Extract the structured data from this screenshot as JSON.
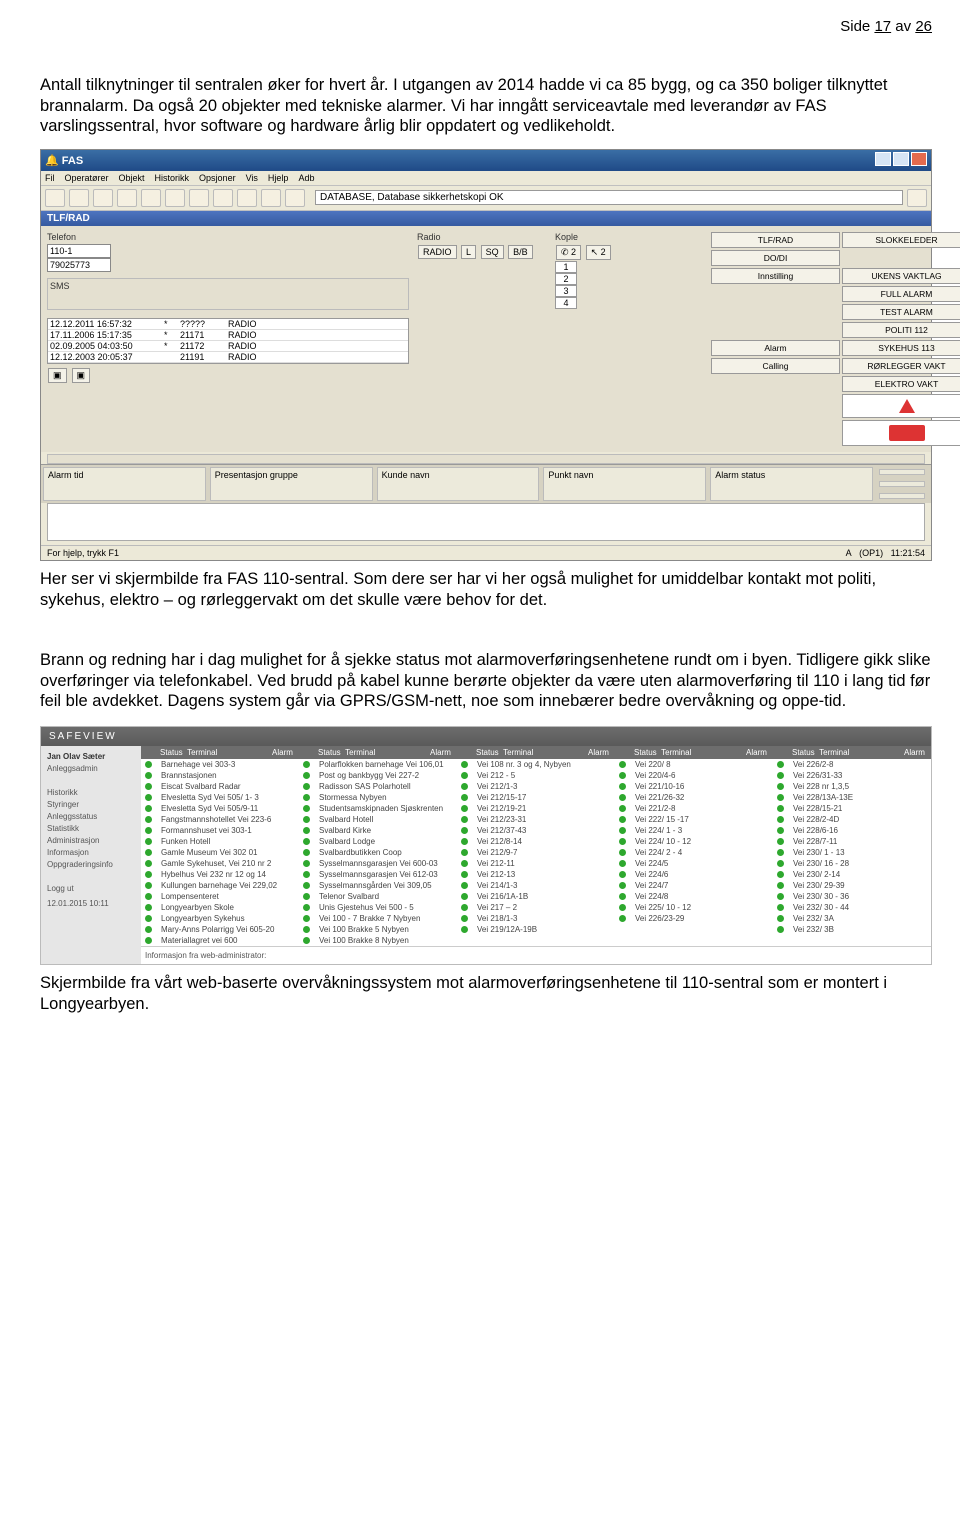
{
  "page_number_prefix": "Side ",
  "page_number_cur": "17",
  "page_number_mid": " av ",
  "page_number_total": "26",
  "para1": "Antall tilknytninger til sentralen øker for hvert år. I utgangen av 2014 hadde vi ca 85 bygg, og ca 350 boliger tilknyttet brannalarm. Da også 20 objekter med tekniske alarmer. Vi har inngått serviceavtale med leverandør av FAS varslingssentral, hvor software og hardware årlig blir oppdatert og vedlikeholdt.",
  "para2": "Her ser vi skjermbilde fra FAS 110-sentral. Som dere ser har vi her også mulighet for umiddelbar kontakt mot politi, sykehus, elektro – og rørleggervakt om det skulle være behov for det.",
  "para3": "Brann og redning har i dag mulighet for å sjekke status mot alarmoverføringsenhetene rundt om i byen. Tidligere gikk slike overføringer via telefonkabel. Ved brudd på kabel kunne berørte objekter da være uten alarmoverføring til 110 i lang tid før feil ble avdekket. Dagens system går via GPRS/GSM-nett, noe som innebærer bedre overvåkning og oppe-tid.",
  "para4": "Skjermbilde fra vårt web-baserte overvåkningssystem mot alarmoverføringsenhetene til 110-sentral som er montert i Longyearbyen.",
  "fas": {
    "title": "FAS",
    "menu": [
      "Fil",
      "Operatører",
      "Objekt",
      "Historikk",
      "Opsjoner",
      "Vis",
      "Hjelp",
      "Adb"
    ],
    "db_label": "DATABASE, Database sikkerhetskopi OK",
    "tlfrad": "TLF/RAD",
    "grp_tel": "Telefon",
    "grp_radio": "Radio",
    "grp_kople": "Kople",
    "tel1": "110-1",
    "tel2": "79025773",
    "radiobtn": "RADIO",
    "r_l": "L",
    "r_sq": "SQ",
    "r_bb": "B/B",
    "kople_hand1": "✆ 2",
    "kople_hand2": "↖ 2",
    "kople_nums": [
      "1",
      "2",
      "3",
      "4"
    ],
    "sms": "SMS",
    "log": [
      {
        "t": "12.12.2011 16:57:32",
        "s": "*",
        "c": "?????",
        "r": "RADIO"
      },
      {
        "t": "17.11.2006 15:17:35",
        "s": "*",
        "c": "21171",
        "r": "RADIO"
      },
      {
        "t": "02.09.2005 04:03:50",
        "s": "*",
        "c": "21172",
        "r": "RADIO"
      },
      {
        "t": "12.12.2003 20:05:37",
        "s": "",
        "c": "21191",
        "r": "RADIO"
      }
    ],
    "right_top": [
      [
        "TLF/RAD",
        "SLOKKELEDER"
      ],
      [
        "DO/DI",
        ""
      ],
      [
        "Innstilling",
        "UKENS VAKTLAG"
      ],
      [
        "",
        "FULL ALARM"
      ],
      [
        "",
        "TEST ALARM"
      ],
      [
        "",
        "POLITI 112"
      ],
      [
        "Alarm",
        "SYKEHUS 113"
      ],
      [
        "Calling",
        "RØRLEGGER VAKT"
      ],
      [
        "",
        "ELEKTRO VAKT"
      ]
    ],
    "alarm_cols": [
      "Alarm tid",
      "Presentasjon gruppe",
      "Kunde navn",
      "Punkt navn",
      "Alarm status"
    ],
    "statusbar_left": "For hjelp, trykk F1",
    "statusbar_a": "A",
    "statusbar_op": "(OP1)",
    "statusbar_time": "11:21:54"
  },
  "sv": {
    "brand": "SAFEVIEW",
    "user": "Jan Olav Sæter",
    "side": [
      "Anleggsadmin",
      "",
      "Historikk",
      "Styringer",
      "Anleggsstatus",
      "Statistikk",
      "Administrasjon",
      "Informasjon",
      "Oppgraderingsinfo",
      "",
      "Logg ut"
    ],
    "timestamp": "12.01.2015\n10:11",
    "hdr": [
      "Status",
      "Terminal",
      "Alarm"
    ],
    "cols": [
      [
        "Barnehage vei 303-3",
        "Brannstasjonen",
        "Eiscat Svalbard Radar",
        "Elvesletta Syd Vei 505/ 1- 3",
        "Elvesletta Syd Vei 505/9-11",
        "Fangstmannshotellet Vei 223-6",
        "Formannshuset vei 303-1",
        "Funken Hotell",
        "Gamle Museum Vei 302 01",
        "Gamle Sykehuset, Vei 210 nr 2",
        "Hybelhus Vei 232 nr 12 og 14",
        "Kullungen barnehage Vei 229,02",
        "Lompensenteret",
        "Longyearbyen Skole",
        "Longyearbyen Sykehus",
        "Mary-Anns Polarrigg Vei 605-20",
        "Materiallagret vei 600"
      ],
      [
        "Polarflokken barnehage Vei 106,01",
        "Post og bankbygg Vei 227-2",
        "Radisson SAS Polarhotell",
        "Stormessa Nybyen",
        "Studentsamskipnaden Sjøskrenten",
        "Svalbard Hotell",
        "Svalbard Kirke",
        "Svalbard Lodge",
        "Svalbardbutikken Coop",
        "Sysselmannsgarasjen Vei 600-03",
        "Sysselmannsgarasjen Vei 612-03",
        "Sysselmannsgården Vei 309,05",
        "Telenor Svalbard",
        "Unis Gjestehus Vei 500 - 5",
        "Vei 100 - 7 Brakke 7 Nybyen",
        "Vei 100 Brakke 5 Nybyen",
        "Vei 100 Brakke 8 Nybyen"
      ],
      [
        "Vei 108 nr. 3 og 4, Nybyen",
        "Vei 212 - 5",
        "Vei 212/1-3",
        "Vei 212/15-17",
        "Vei 212/19-21",
        "Vei 212/23-31",
        "Vei 212/37-43",
        "Vei 212/8-14",
        "Vei 212/9-7",
        "Vei 212-11",
        "Vei 212-13",
        "Vei 214/1-3",
        "Vei 216/1A-1B",
        "Vei 217 – 2",
        "Vei 218/1-3",
        "Vei 219/12A-19B"
      ],
      [
        "Vei 220/ 8",
        "Vei 220/4-6",
        "Vei 221/10-16",
        "Vei 221/26-32",
        "Vei 221/2-8",
        "Vei 222/ 15 -17",
        "Vei 224/ 1 - 3",
        "Vei 224/ 10 - 12",
        "Vei 224/ 2 - 4",
        "Vei 224/5",
        "Vei 224/6",
        "Vei 224/7",
        "Vei 224/8",
        "Vei 225/ 10 - 12",
        "Vei 226/23-29"
      ],
      [
        "Vei 226/2-8",
        "Vei 226/31-33",
        "Vei 228 nr 1,3,5",
        "Vei 228/13A-13E",
        "Vei 228/15-21",
        "Vei 228/2-4D",
        "Vei 228/6-16",
        "Vei 228/7-11",
        "Vei 230/ 1 - 13",
        "Vei 230/ 16 - 28",
        "Vei 230/ 2-14",
        "Vei 230/ 29-39",
        "Vei 230/ 30 - 36",
        "Vei 232/ 30 - 44",
        "Vei 232/ 3A",
        "Vei 232/ 3B"
      ]
    ],
    "footer": "Informasjon fra web-administrator:"
  }
}
